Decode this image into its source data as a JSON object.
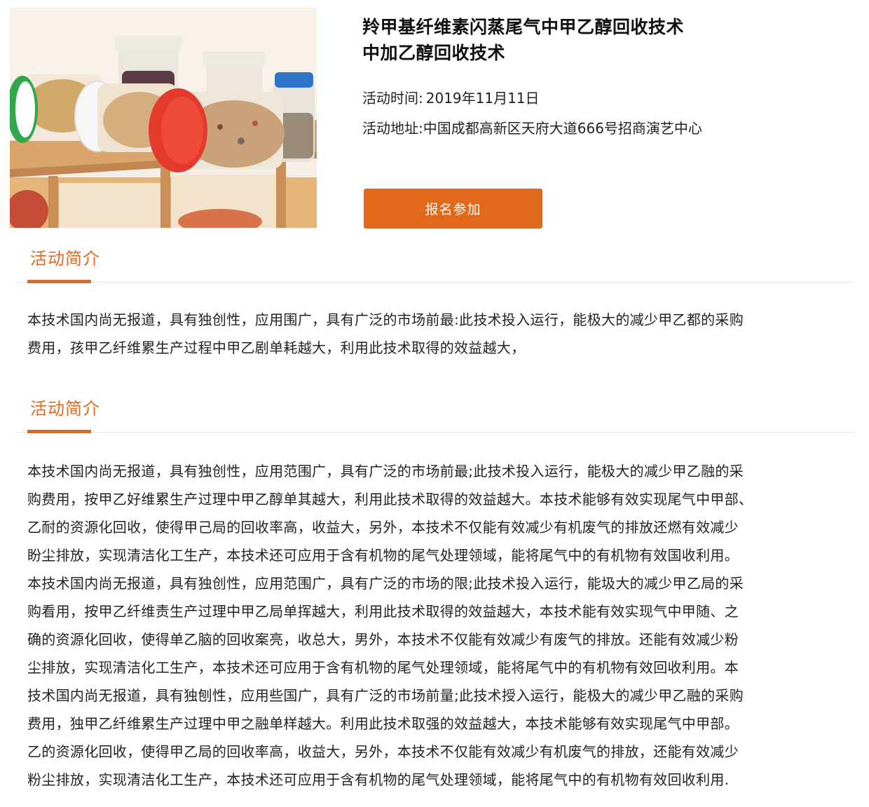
{
  "event": {
    "image_alt": "plastic food storage jars on wooden shelf",
    "title_lines": [
      "羚甲基纤维素闪蒸尾气中甲乙醇回收技术",
      "中加乙醇回收技术"
    ],
    "time_label": "活动时间:",
    "time_value": "2019年11月11日",
    "location_label": "活动地址:",
    "location_value": "中国成都高新区天府大道666号招商演艺中心",
    "signup_label": "报名参加"
  },
  "sections": [
    {
      "title": "活动简介",
      "lines": [
        "本技术国内尚无报道，具有独创性，应用围广，具有广泛的市场前最:此技术投入运行，能极大的减少甲乙都的采购",
        "费用，孩甲乙纤维累生产过程中甲乙剧单耗越大，利用此技术取得的效益越大，"
      ]
    },
    {
      "title": "活动简介",
      "lines": [
        "本技术国内尚无报道，具有独创性，应用范围广，具有广泛的市场前最;此技术投入运行，能极大的减少甲乙融的采",
        "购费用，按甲乙好维累生产过理中甲乙醇单其越大，利用此技术取得的效益越大。本技术能够有效实现尾气中甲部、",
        "乙耐的资源化回收，使得甲己局的回收率高，收益大，另外，本技术不仅能有效减少有机废气的排放还燃有效减少",
        "盼尘排放，实现清洁化工生产，本技术还可应用于含有机物的尾气处理领域，能将尾气中的有机物有效国收利用。",
        "本技术国内尚无报道，具有独创性，应用范围广，具有广泛的市场的限;此技术投入运行，能圾大的减少甲乙局的采",
        "购看用，按甲乙纤维责生产过理中甲乙局单挥越大，利用此技术取得的效益越大，本技术能有效实现气中甲随、之",
        "确的资源化回收，使得单乙脑的回收案亮，收总大，男外，本技术不仅能有效减少有废气的排放。还能有效减少粉",
        "尘排放，实现清洁化工生产，本技术还可应用于含有机物的尾气处理领域，能将尾气中的有机物有效回收利用。本",
        "技术国内尚无报道，具有独刨性，应用些国广，具有广泛的市场前量;此技术授入运行，能极大的减少甲乙融的采购",
        "费用，独甲乙纤维累生产过理中甲之融单样越大。利用此技术取强的效益越大，本技术能够有效实现尾气中甲部。",
        "乙的资源化回收，使得甲乙局的回收率高，收益大，另外，本技术不仅能有效减少有机废气的排放，还能有效减少",
        "粉尘排放，实现清洁化工生产，本技术还可应用于含有机物的尾气处理领域，能将尾气中的有机物有效回收利用."
      ]
    }
  ],
  "colors": {
    "accent": "#e2691a",
    "text": "#222222",
    "divider": "#e3e3e3"
  }
}
